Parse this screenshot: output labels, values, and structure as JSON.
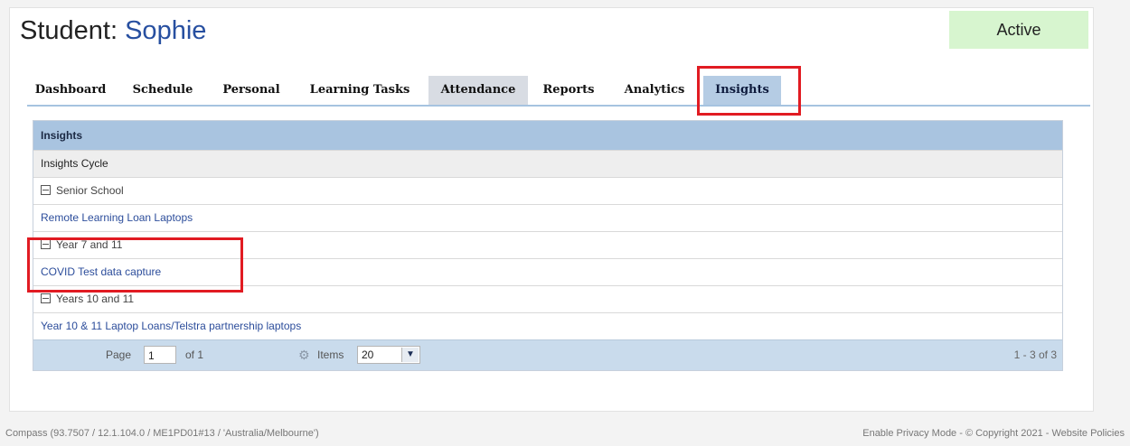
{
  "header": {
    "title_prefix": "Student:",
    "student_name": "Sophie",
    "status": "Active"
  },
  "tabs": [
    {
      "label": "Dashboard",
      "style": "plain"
    },
    {
      "label": "Schedule",
      "style": "plain"
    },
    {
      "label": "Personal",
      "style": "plain"
    },
    {
      "label": "Learning Tasks",
      "style": "plain"
    },
    {
      "label": "Attendance",
      "style": "gray"
    },
    {
      "label": "Reports",
      "style": "plain"
    },
    {
      "label": "Analytics",
      "style": "plain"
    },
    {
      "label": "Insights",
      "style": "selected"
    }
  ],
  "grid": {
    "title": "Insights",
    "cycle_label": "Insights Cycle",
    "groups": [
      {
        "name": "Senior School",
        "items": [
          "Remote Learning Loan Laptops"
        ]
      },
      {
        "name": "Year 7 and 11",
        "items": [
          "COVID Test data capture"
        ]
      },
      {
        "name": "Years 10 and 11",
        "items": [
          "Year 10 & 11 Laptop Loans/Telstra partnership laptops"
        ]
      }
    ],
    "pager": {
      "page_label": "Page",
      "page_value": "1",
      "of_label": "of 1",
      "items_label": "Items",
      "items_value": "20",
      "count_text": "1 - 3 of 3"
    }
  },
  "footer": {
    "left": "Compass (93.7507 / 12.1.104.0 / ME1PD01#13 / 'Australia/Melbourne')",
    "right": "Enable Privacy Mode - © Copyright 2021 - Website Policies"
  },
  "colors": {
    "accent_blue": "#274fa0",
    "selected_tab": "#b5cce4",
    "status_bg": "#d7f5cf",
    "highlight": "#e11b22"
  }
}
